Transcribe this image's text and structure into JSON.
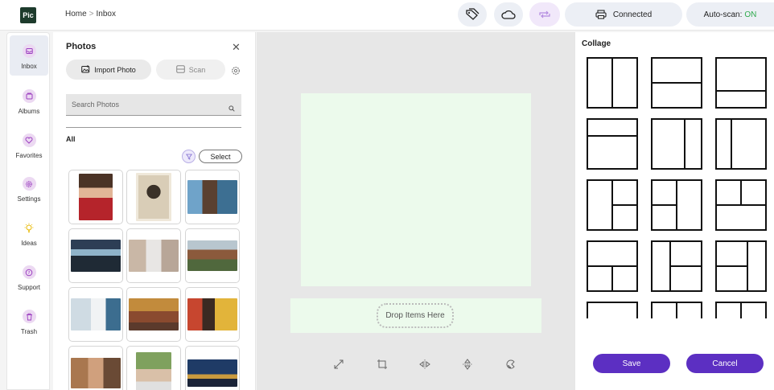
{
  "app": {
    "logo_text": "Pic"
  },
  "breadcrumb": {
    "home": "Home",
    "separator": ">",
    "current": "Inbox"
  },
  "topbar": {
    "status_label": "Connected",
    "autoscan_label": "Auto-scan:",
    "autoscan_value": "ON",
    "icons": [
      "tags-icon",
      "cloud-icon",
      "sync-icon",
      "printer-icon"
    ]
  },
  "nav": {
    "items": [
      {
        "label": "Inbox",
        "icon": "inbox-icon",
        "active": true
      },
      {
        "label": "Albums",
        "icon": "albums-icon"
      },
      {
        "label": "Favorites",
        "icon": "heart-icon"
      },
      {
        "label": "Settings",
        "icon": "gear-icon"
      },
      {
        "label": "Ideas",
        "icon": "lightbulb-icon"
      },
      {
        "label": "Support",
        "icon": "help-icon"
      },
      {
        "label": "Trash",
        "icon": "trash-icon"
      }
    ]
  },
  "photos": {
    "title": "Photos",
    "import_label": "Import Photo",
    "scan_label": "Scan",
    "search_placeholder": "Search Photos",
    "filter_label": "All",
    "select_label": "Select"
  },
  "canvas": {
    "drop_label": "Drop Items Here"
  },
  "collage": {
    "title": "Collage",
    "save_label": "Save",
    "cancel_label": "Cancel"
  },
  "colors": {
    "accent": "#5c2fc2",
    "canvas_green": "#ecfaec",
    "on_green": "#2eaa4d"
  }
}
